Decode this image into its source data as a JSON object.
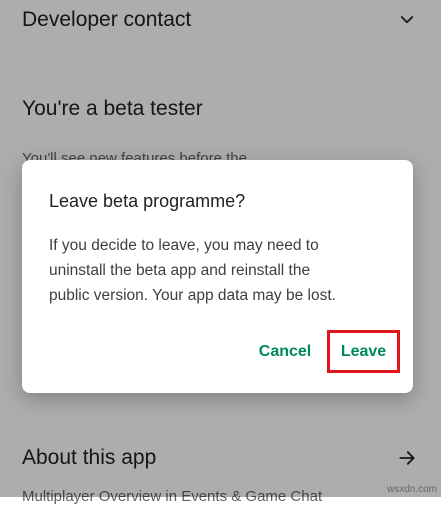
{
  "page": {
    "developer_contact": "Developer contact",
    "beta_heading": "You're a beta tester",
    "beta_body_partial": "You'll see new features before the",
    "about_heading": "About this app",
    "about_body_partial": "Multiplayer Overview in Events & Game Chat"
  },
  "dialog": {
    "title": "Leave beta programme?",
    "message_lines": [
      "If you decide to leave, you may need to",
      "uninstall the beta app and reinstall the",
      "public version. Your app data may be lost."
    ],
    "cancel_label": "Cancel",
    "leave_label": "Leave"
  },
  "colors": {
    "accent": "#01875f",
    "highlight_border": "#e1161c"
  },
  "icons": {
    "developer_contact": "chevron-down-icon",
    "about": "arrow-right-icon"
  },
  "watermark": "wsxdn.com"
}
